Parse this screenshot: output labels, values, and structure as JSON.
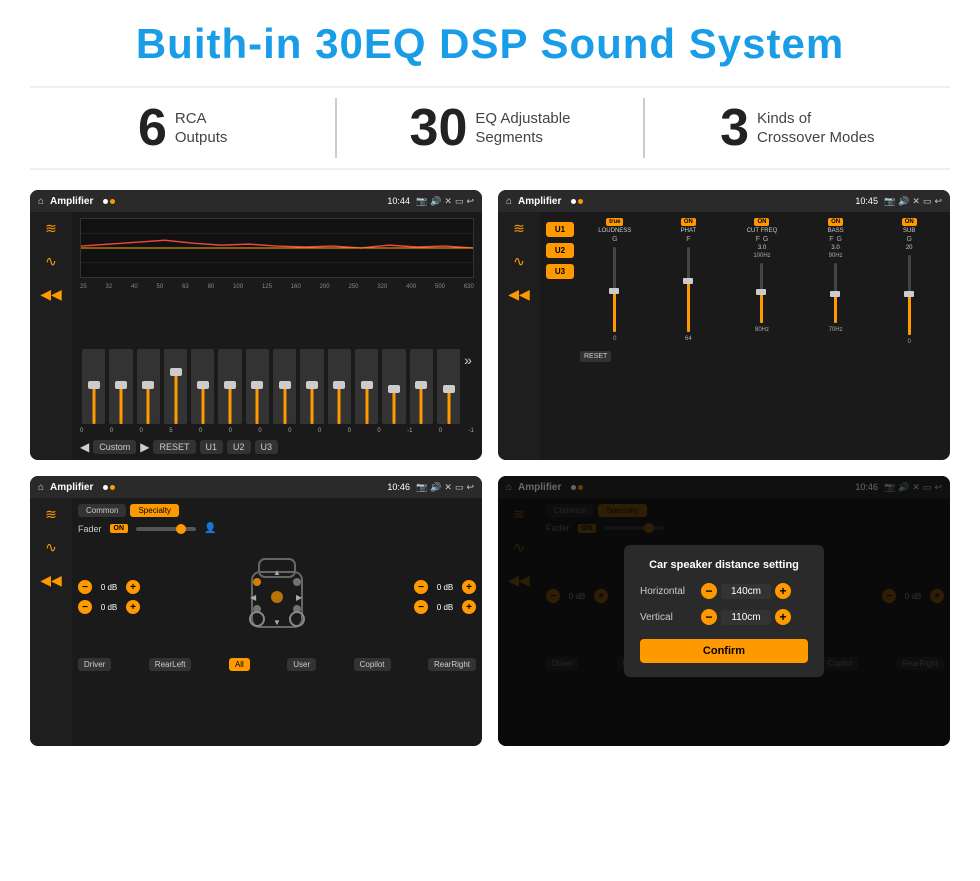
{
  "header": {
    "title": "Buith-in 30EQ DSP Sound System"
  },
  "stats": [
    {
      "number": "6",
      "label_line1": "RCA",
      "label_line2": "Outputs"
    },
    {
      "number": "30",
      "label_line1": "EQ Adjustable",
      "label_line2": "Segments"
    },
    {
      "number": "3",
      "label_line1": "Kinds of",
      "label_line2": "Crossover Modes"
    }
  ],
  "screens": [
    {
      "id": "eq-screen",
      "topbar": {
        "title": "Amplifier",
        "time": "10:44"
      },
      "eq_freqs": [
        "25",
        "32",
        "40",
        "50",
        "63",
        "80",
        "100",
        "125",
        "160",
        "200",
        "250",
        "320",
        "400",
        "500",
        "630"
      ],
      "eq_values": [
        "0",
        "0",
        "0",
        "5",
        "0",
        "0",
        "0",
        "0",
        "0",
        "0",
        "0",
        "-1",
        "0",
        "-1"
      ],
      "controls": [
        "Custom",
        "RESET",
        "U1",
        "U2",
        "U3"
      ]
    },
    {
      "id": "crossover-screen",
      "topbar": {
        "title": "Amplifier",
        "time": "10:45"
      },
      "presets": [
        "U1",
        "U2",
        "U3"
      ],
      "channels": [
        {
          "on": true,
          "label": "LOUDNESS"
        },
        {
          "on": true,
          "label": "PHAT"
        },
        {
          "on": true,
          "label": "CUT FREQ"
        },
        {
          "on": true,
          "label": "BASS"
        },
        {
          "on": true,
          "label": "SUB"
        }
      ],
      "reset_label": "RESET"
    },
    {
      "id": "fader-screen",
      "topbar": {
        "title": "Amplifier",
        "time": "10:46"
      },
      "tabs": [
        "Common",
        "Specialty"
      ],
      "fader_label": "Fader",
      "fader_on": "ON",
      "vol_labels": [
        "0 dB",
        "0 dB",
        "0 dB",
        "0 dB"
      ],
      "bottom_btns": [
        "Driver",
        "RearLeft",
        "All",
        "User",
        "Copilot",
        "RearRight"
      ]
    },
    {
      "id": "distance-screen",
      "topbar": {
        "title": "Amplifier",
        "time": "10:46"
      },
      "tabs": [
        "Common",
        "Specialty"
      ],
      "modal": {
        "title": "Car speaker distance setting",
        "horizontal_label": "Horizontal",
        "horizontal_value": "140cm",
        "vertical_label": "Vertical",
        "vertical_value": "110cm",
        "confirm_label": "Confirm"
      },
      "vol_labels": [
        "0 dB",
        "0 dB"
      ],
      "bottom_btns": [
        "Driver",
        "RearLeft",
        "All",
        "User",
        "Copilot",
        "RearRight"
      ]
    }
  ]
}
